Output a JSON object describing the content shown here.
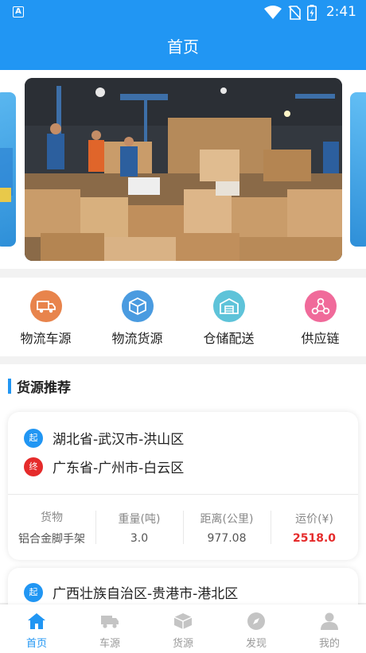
{
  "status_bar": {
    "time": "2:41",
    "left_icon": "A",
    "icons": [
      "wifi-icon",
      "no-sim-icon",
      "battery-charging-icon"
    ]
  },
  "app_bar": {
    "title": "首页"
  },
  "banner": {
    "description_icon": "warehouse-parcels-photo"
  },
  "categories": [
    {
      "label": "物流车源",
      "icon": "truck-icon",
      "color": "#e8844c"
    },
    {
      "label": "物流货源",
      "icon": "cube-icon",
      "color": "#4a9be0"
    },
    {
      "label": "仓储配送",
      "icon": "warehouse-icon",
      "color": "#5ec3d9"
    },
    {
      "label": "供应链",
      "icon": "network-icon",
      "color": "#f06a9a"
    }
  ],
  "section": {
    "title": "货源推荐"
  },
  "cards": [
    {
      "origin_badge": "起",
      "origin": "湖北省-武汉市-洪山区",
      "dest_badge": "终",
      "destination": "广东省-广州市-白云区",
      "stats": [
        {
          "header": "货物",
          "value": "铝合金脚手架"
        },
        {
          "header": "重量(吨)",
          "value": "3.0"
        },
        {
          "header": "距离(公里)",
          "value": "977.08"
        },
        {
          "header": "运价(¥)",
          "value": "2518.0"
        }
      ]
    },
    {
      "origin_badge": "起",
      "origin": "广西壮族自治区-贵港市-港北区"
    }
  ],
  "bottom_nav": [
    {
      "label": "首页",
      "icon": "home-icon",
      "active": true
    },
    {
      "label": "车源",
      "icon": "truck-icon",
      "active": false
    },
    {
      "label": "货源",
      "icon": "cube-icon",
      "active": false
    },
    {
      "label": "发现",
      "icon": "compass-icon",
      "active": false
    },
    {
      "label": "我的",
      "icon": "person-icon",
      "active": false
    }
  ],
  "colors": {
    "primary": "#2196F3",
    "origin": "#2196F3",
    "destination": "#e52b2b",
    "price": "#e52b2b"
  }
}
